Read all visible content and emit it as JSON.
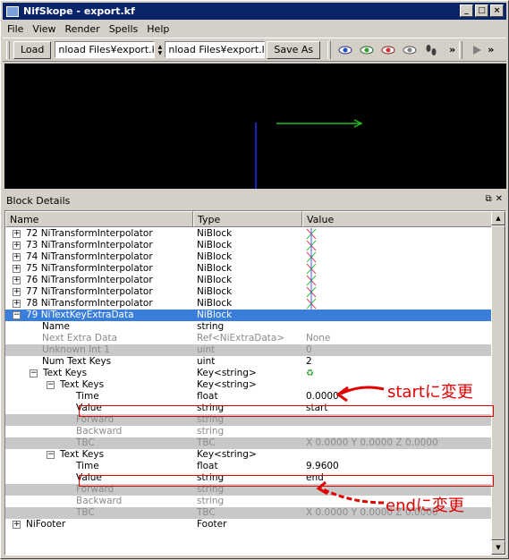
{
  "window": {
    "title": "NifSkope - export.kf"
  },
  "menu": [
    "File",
    "View",
    "Render",
    "Spells",
    "Help"
  ],
  "toolbar": {
    "load_label": "Load",
    "load_path": "nload Files¥export.kf",
    "save_path": "nload Files¥export.kf",
    "save_label": "Save As",
    "overflow": "»"
  },
  "dock": {
    "title": "Block Details"
  },
  "table": {
    "headers": {
      "name": "Name",
      "type": "Type",
      "value": "Value"
    },
    "rows": [
      {
        "name": "72 NiTransformInterpolator",
        "type": "NiBlock",
        "value": ""
      },
      {
        "name": "73 NiTransformInterpolator",
        "type": "NiBlock",
        "value": ""
      },
      {
        "name": "74 NiTransformInterpolator",
        "type": "NiBlock",
        "value": ""
      },
      {
        "name": "75 NiTransformInterpolator",
        "type": "NiBlock",
        "value": ""
      },
      {
        "name": "76 NiTransformInterpolator",
        "type": "NiBlock",
        "value": ""
      },
      {
        "name": "77 NiTransformInterpolator",
        "type": "NiBlock",
        "value": ""
      },
      {
        "name": "78 NiTransformInterpolator",
        "type": "NiBlock",
        "value": ""
      },
      {
        "name": "79 NiTextKeyExtraData",
        "type": "NiBlock",
        "value": ""
      },
      {
        "name": "Name",
        "type": "string",
        "value": ""
      },
      {
        "name": "Next Extra Data",
        "type": "Ref<NiExtraData>",
        "value": "None"
      },
      {
        "name": "Unknown Int 1",
        "type": "uint",
        "value": "0"
      },
      {
        "name": "Num Text Keys",
        "type": "uint",
        "value": "2"
      },
      {
        "name": "Text Keys",
        "type": "Key<string>",
        "value": ""
      },
      {
        "name": "Text Keys",
        "type": "Key<string>",
        "value": ""
      },
      {
        "name": "Time",
        "type": "float",
        "value": "0.0000"
      },
      {
        "name": "Value",
        "type": "string",
        "value": "start"
      },
      {
        "name": "Forward",
        "type": "string",
        "value": ""
      },
      {
        "name": "Backward",
        "type": "string",
        "value": ""
      },
      {
        "name": "TBC",
        "type": "TBC",
        "value": "X 0.0000 Y 0.0000 Z 0.0000"
      },
      {
        "name": "Text Keys",
        "type": "Key<string>",
        "value": ""
      },
      {
        "name": "Time",
        "type": "float",
        "value": "9.9600"
      },
      {
        "name": "Value",
        "type": "string",
        "value": "end"
      },
      {
        "name": "Forward",
        "type": "string",
        "value": ""
      },
      {
        "name": "Backward",
        "type": "string",
        "value": ""
      },
      {
        "name": "TBC",
        "type": "TBC",
        "value": "X 0.0000 Y 0.0000 Z 0.0000"
      },
      {
        "name": "NiFooter",
        "type": "Footer",
        "value": ""
      }
    ]
  },
  "annotations": {
    "start": "startに変更",
    "end": "endに変更"
  },
  "colors": {
    "selection": "#3a7edb",
    "annotation": "#e00000",
    "viewport": "#000000"
  }
}
